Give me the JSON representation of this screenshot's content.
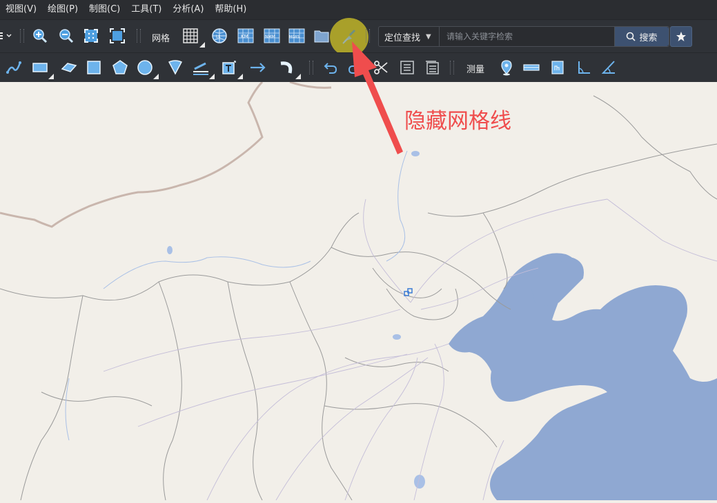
{
  "menu": [
    {
      "label": "视图(V)"
    },
    {
      "label": "绘图(P)"
    },
    {
      "label": "制图(C)"
    },
    {
      "label": "工具(T)"
    },
    {
      "label": "分析(A)"
    },
    {
      "label": "帮助(H)"
    }
  ],
  "toolbar1": {
    "grid_label": "网格",
    "grid_buttons": [
      "LL",
      "KM",
      "NMM",
      "MGRS"
    ],
    "locate_select": "定位查找",
    "search_placeholder": "请输入关键字检索",
    "search_button": "搜索"
  },
  "toolbar2": {
    "measure_label": "测量"
  },
  "annotation": {
    "text": "隐藏网格线",
    "color": "#ef4d4d"
  },
  "colors": {
    "land": "#f2efe9",
    "water": "#8fa8d2",
    "toolbar": "#2f3237",
    "accent": "#3d5170"
  }
}
